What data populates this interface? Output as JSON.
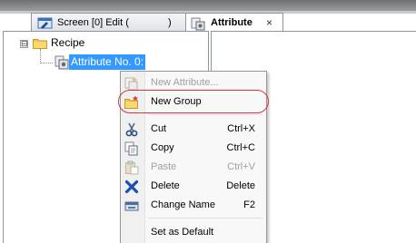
{
  "tabs": [
    {
      "label": "Screen [0] Edit (",
      "label_tail": ")",
      "icon": "screen-edit-icon",
      "active": false
    },
    {
      "label": "Attribute",
      "icon": "attribute-tab-icon",
      "active": true,
      "close_glyph": "×"
    }
  ],
  "tree": {
    "expander_glyph": "⊟",
    "root_label": "Recipe",
    "root_icon": "folder-icon",
    "child_label": "Attribute No. 0:",
    "child_icon": "attribute-icon"
  },
  "context_menu": {
    "items": [
      {
        "label": "New Attribute...",
        "shortcut": "",
        "icon": "new-attribute-icon",
        "enabled": false
      },
      {
        "label": "New Group",
        "shortcut": "",
        "icon": "new-group-icon",
        "enabled": true,
        "highlighted": true
      },
      {
        "label": "Cut",
        "shortcut": "Ctrl+X",
        "icon": "scissors-icon",
        "enabled": true
      },
      {
        "label": "Copy",
        "shortcut": "Ctrl+C",
        "icon": "copy-icon",
        "enabled": true
      },
      {
        "label": "Paste",
        "shortcut": "Ctrl+V",
        "icon": "paste-icon",
        "enabled": false
      },
      {
        "label": "Delete",
        "shortcut": "Delete",
        "icon": "delete-icon",
        "enabled": true
      },
      {
        "label": "Change Name",
        "shortcut": "F2",
        "icon": "rename-icon",
        "enabled": true
      },
      {
        "label": "Set as Default",
        "shortcut": "",
        "icon": "",
        "enabled": true
      }
    ]
  },
  "colors": {
    "selection": "#3399ff",
    "highlight_ring": "#d9363e",
    "disabled_text": "#a0a0a0"
  }
}
